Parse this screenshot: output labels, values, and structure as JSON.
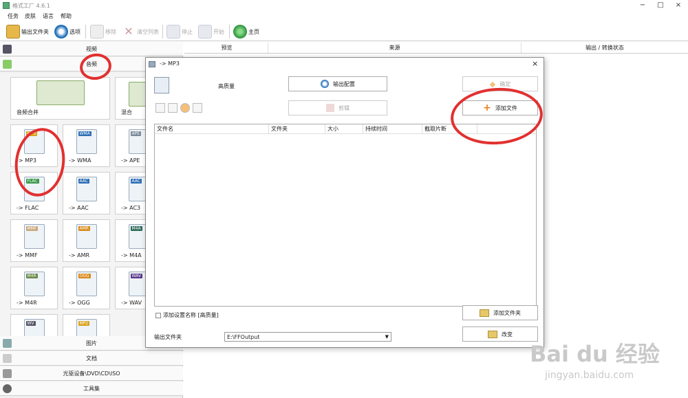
{
  "window": {
    "title": "格式工厂 4.6.1"
  },
  "menu": [
    "任务",
    "皮肤",
    "语言",
    "帮助"
  ],
  "toolbar": {
    "output_folder": "输出文件夹",
    "options": "选项",
    "remove": "移除",
    "clear_list": "清空列表",
    "stop": "停止",
    "start": "开始",
    "home": "主页"
  },
  "left": {
    "video": "视频",
    "audio": "音频",
    "picture": "图片",
    "document": "文档",
    "rom": "光驱设备\\DVD\\CD\\ISO",
    "tools": "工具集",
    "tiles": [
      {
        "label": "音频合并",
        "badge": ""
      },
      {
        "label": "混合",
        "badge": ""
      },
      {
        "label": "-> MP3",
        "badge": "MP3"
      },
      {
        "label": "-> WMA",
        "badge": "WMA"
      },
      {
        "label": "-> APE",
        "badge": "APE"
      },
      {
        "label": "-> FLAC",
        "badge": "FLAC"
      },
      {
        "label": "-> AAC",
        "badge": "AAC"
      },
      {
        "label": "-> AC3",
        "badge": "AAC"
      },
      {
        "label": "-> MMF",
        "badge": "MMF"
      },
      {
        "label": "-> AMR",
        "badge": "AMR"
      },
      {
        "label": "-> M4A",
        "badge": "M4A"
      },
      {
        "label": "-> M4R",
        "badge": "M4R"
      },
      {
        "label": "-> OGG",
        "badge": "OGG"
      },
      {
        "label": "-> WAV",
        "badge": "WAV"
      },
      {
        "label": "",
        "badge": "WV"
      },
      {
        "label": "",
        "badge": "MP2"
      }
    ]
  },
  "columns": {
    "preview": "预览",
    "source": "来源",
    "status": "输出 / 转换状态"
  },
  "dialog": {
    "title": "-> MP3",
    "close": "×",
    "quality": "高质量",
    "output_config": "输出配置",
    "edit": "剪辑",
    "ok": "确定",
    "add_file": "添加文件",
    "add_folder": "添加文件夹",
    "change": "改变",
    "table_headers": [
      "文件名",
      "文件夹",
      "大小",
      "持续时间",
      "截取片断"
    ],
    "add_setting_name": "添加设置名称 [高质量]",
    "output_folder_label": "输出文件夹",
    "output_folder_value": "E:\\FFOutput"
  },
  "watermark": {
    "main": "Bai du 经验",
    "sub": "jingyan.baidu.com"
  },
  "colors": {
    "annotation": "#e23030",
    "accent": "#1e6fb8"
  }
}
